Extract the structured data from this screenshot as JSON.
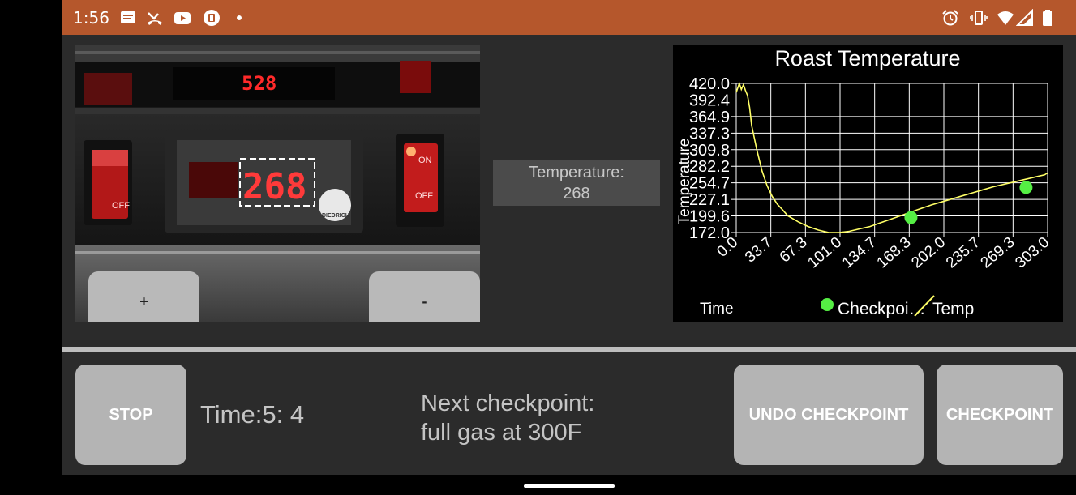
{
  "statusbar": {
    "time": "1:56",
    "left_icons": [
      "notes-icon",
      "missed-call-icon",
      "youtube-icon",
      "toolbox-icon",
      "dot-icon"
    ],
    "right_icons": [
      "alarm-icon",
      "vibrate-icon",
      "wifi-icon",
      "signal-icon",
      "battery-icon"
    ]
  },
  "camera": {
    "top_display": "528",
    "detected_display": "268",
    "switch_on_label": "ON",
    "switch_off_label": "OFF",
    "left_switch_label": "OFF",
    "badge_text": "DIEDRICH",
    "plus_label": "+",
    "minus_label": "-"
  },
  "temperature": {
    "label": "Temperature:",
    "value": "268"
  },
  "chart_data": {
    "type": "line",
    "title": "Roast Temperature",
    "xlabel": "Time",
    "ylabel": "Temperature",
    "xlim": [
      0,
      303
    ],
    "ylim": [
      172,
      420
    ],
    "x_ticks": [
      "0.0",
      "33.7",
      "67.3",
      "101.0",
      "134.7",
      "168.3",
      "202.0",
      "235.7",
      "269.3",
      "303.0"
    ],
    "y_ticks": [
      "420.0",
      "392.4",
      "364.9",
      "337.3",
      "309.8",
      "282.2",
      "254.7",
      "227.1",
      "199.6",
      "172.0"
    ],
    "grid": true,
    "legend": [
      "Checkpoi…",
      "Temp"
    ],
    "series": [
      {
        "name": "Temp",
        "color": "#ffff66",
        "x": [
          0,
          3,
          5,
          7,
          9,
          11,
          13,
          15,
          20,
          25,
          30,
          35,
          40,
          45,
          50,
          60,
          70,
          80,
          90,
          100,
          110,
          120,
          130,
          140,
          150,
          160,
          170,
          180,
          190,
          200,
          210,
          220,
          230,
          240,
          250,
          260,
          270,
          280,
          290,
          300,
          310
        ],
        "y": [
          405,
          420,
          410,
          418,
          408,
          400,
          380,
          350,
          310,
          275,
          250,
          232,
          219,
          210,
          200,
          190,
          182,
          176,
          172,
          172,
          174,
          178,
          182,
          188,
          194,
          200,
          206,
          212,
          218,
          223,
          228,
          233,
          238,
          243,
          248,
          252,
          256,
          260,
          264,
          268,
          271
        ]
      },
      {
        "name": "Checkpoint",
        "color": "#55ee44",
        "x": [
          170,
          282
        ],
        "y": [
          197,
          247
        ]
      }
    ]
  },
  "bottom": {
    "stop_label": "STOP",
    "time_text": "Time:5: 4",
    "next_line1": "Next checkpoint:",
    "next_line2": "full gas at 300F",
    "undo_label": "UNDO CHECKPOINT",
    "checkpoint_label": "CHECKPOINT"
  }
}
